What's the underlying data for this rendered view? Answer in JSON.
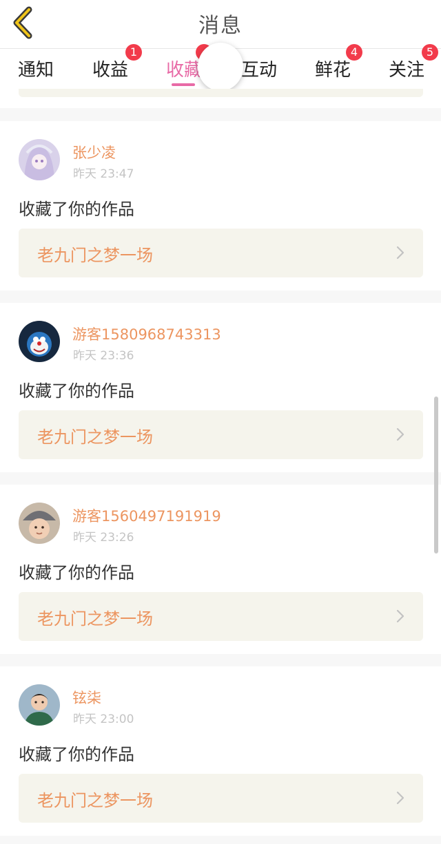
{
  "header": {
    "title": "消息"
  },
  "tabs": [
    {
      "label": "通知",
      "badge": ""
    },
    {
      "label": "收益",
      "badge": "1"
    },
    {
      "label": "收藏",
      "badge": ""
    },
    {
      "label": "互动",
      "badge": ""
    },
    {
      "label": "鲜花",
      "badge": "4"
    },
    {
      "label": "关注",
      "badge": "5"
    }
  ],
  "active_tab": "收藏",
  "colors": {
    "accent": "#e86aa6",
    "username": "#ec9560",
    "badge": "#f23b4b"
  },
  "messages": [
    {
      "user": "张少凌",
      "time": "昨天 23:47",
      "action": "收藏了你的作品",
      "work": "老九门之梦一场"
    },
    {
      "user": "游客1580968743313",
      "time": "昨天 23:36",
      "action": "收藏了你的作品",
      "work": "老九门之梦一场"
    },
    {
      "user": "游客1560497191919",
      "time": "昨天 23:26",
      "action": "收藏了你的作品",
      "work": "老九门之梦一场"
    },
    {
      "user": "铉柒",
      "time": "昨天 23:00",
      "action": "收藏了你的作品",
      "work": "老九门之梦一场"
    }
  ]
}
